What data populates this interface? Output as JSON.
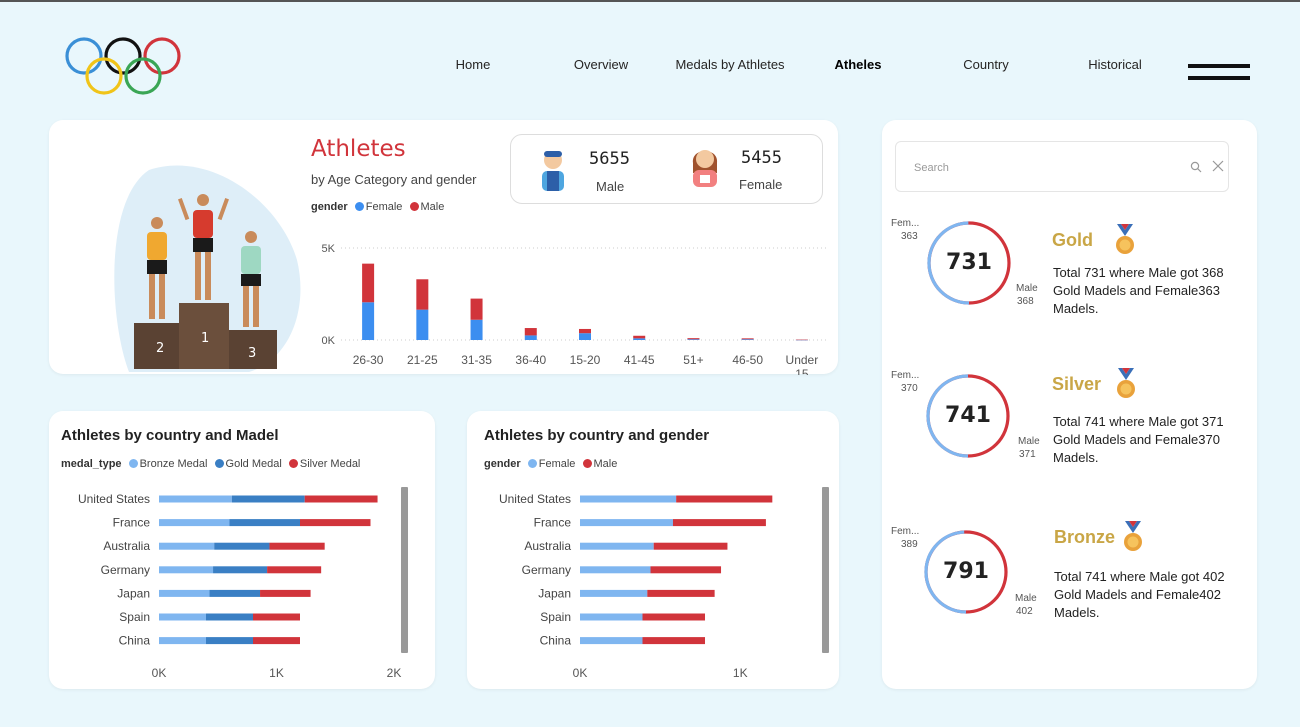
{
  "nav": {
    "items": [
      {
        "label": "Home",
        "active": false
      },
      {
        "label": "Overview",
        "active": false
      },
      {
        "label": "Medals by Athletes",
        "active": false
      },
      {
        "label": "Atheles",
        "active": true
      },
      {
        "label": "Country",
        "active": false
      },
      {
        "label": "Historical",
        "active": false
      }
    ]
  },
  "colors": {
    "female": "#3c8ef0",
    "male": "#d1343b",
    "bronze": "#7fb6f0",
    "gold": "#3a7fc4",
    "silver": "#d1343b",
    "gold_text": "#c9a646"
  },
  "athletes": {
    "title": "Athletes",
    "subtitle": "by Age Category and gender",
    "legend_title": "gender",
    "legend": [
      "Female",
      "Male"
    ],
    "podium": [
      "2",
      "1",
      "3"
    ],
    "kpi": {
      "male_count": "5655",
      "male_label": "Male",
      "female_count": "5455",
      "female_label": "Female"
    }
  },
  "country_medal": {
    "title": "Athletes by country and Madel",
    "legend_title": "medal_type",
    "legend": [
      "Bronze Medal",
      "Gold Medal",
      "Silver Medal"
    ]
  },
  "country_gender": {
    "title": "Athletes by country and gender",
    "legend_title": "gender",
    "legend": [
      "Female",
      "Male"
    ]
  },
  "chart_data": [
    {
      "type": "bar",
      "stacked": true,
      "categories": [
        "26-30",
        "21-25",
        "31-35",
        "36-40",
        "15-20",
        "41-45",
        "51+",
        "46-50",
        "Under 15"
      ],
      "series": [
        {
          "name": "Female",
          "values": [
            2050,
            1650,
            1100,
            250,
            370,
            90,
            40,
            40,
            10
          ]
        },
        {
          "name": "Male",
          "values": [
            2100,
            1650,
            1150,
            400,
            230,
            140,
            60,
            50,
            10
          ]
        }
      ],
      "yticks": [
        "0K",
        "5K"
      ],
      "ylim": [
        0,
        5000
      ],
      "legend": "top-left"
    },
    {
      "type": "bar",
      "orientation": "horizontal",
      "stacked": true,
      "categories": [
        "United States",
        "France",
        "Australia",
        "Germany",
        "Japan",
        "Spain",
        "China"
      ],
      "series": [
        {
          "name": "Bronze Medal",
          "values": [
            620,
            600,
            470,
            460,
            430,
            400,
            400
          ]
        },
        {
          "name": "Gold Medal",
          "values": [
            620,
            600,
            470,
            460,
            430,
            400,
            400
          ]
        },
        {
          "name": "Silver Medal",
          "values": [
            620,
            600,
            470,
            460,
            430,
            400,
            400
          ]
        }
      ],
      "xticks": [
        "0K",
        "1K",
        "2K"
      ],
      "xlim": [
        0,
        2000
      ],
      "legend": "top-left"
    },
    {
      "type": "bar",
      "orientation": "horizontal",
      "stacked": true,
      "categories": [
        "United States",
        "France",
        "Australia",
        "Germany",
        "Japan",
        "Spain",
        "China"
      ],
      "series": [
        {
          "name": "Female",
          "values": [
            600,
            580,
            460,
            440,
            420,
            390,
            390
          ]
        },
        {
          "name": "Male",
          "values": [
            600,
            580,
            460,
            440,
            420,
            390,
            390
          ]
        }
      ],
      "xticks": [
        "0K",
        "1K"
      ],
      "xlim": [
        0,
        1510
      ],
      "legend": "top-left"
    }
  ],
  "medals": {
    "search_placeholder": "Search",
    "items": [
      {
        "name": "Gold",
        "total": "731",
        "female_label": "Fem...",
        "female": "363",
        "male_label": "Male",
        "male": "368",
        "female_frac": 0.4966,
        "desc": "Total 731 where Male got 368 Gold Madels and Female363 Madels."
      },
      {
        "name": "Silver",
        "total": "741",
        "female_label": "Fem...",
        "female": "370",
        "male_label": "Male",
        "male": "371",
        "female_frac": 0.4993,
        "desc": "Total 741 where Male got 371 Gold Madels and Female370 Madels."
      },
      {
        "name": "Bronze",
        "total": "791",
        "female_label": "Fem...",
        "female": "389",
        "male_label": "Male",
        "male": "402",
        "female_frac": 0.4918,
        "desc": "Total 741 where Male got 402 Gold Madels and Female402 Madels."
      }
    ]
  }
}
